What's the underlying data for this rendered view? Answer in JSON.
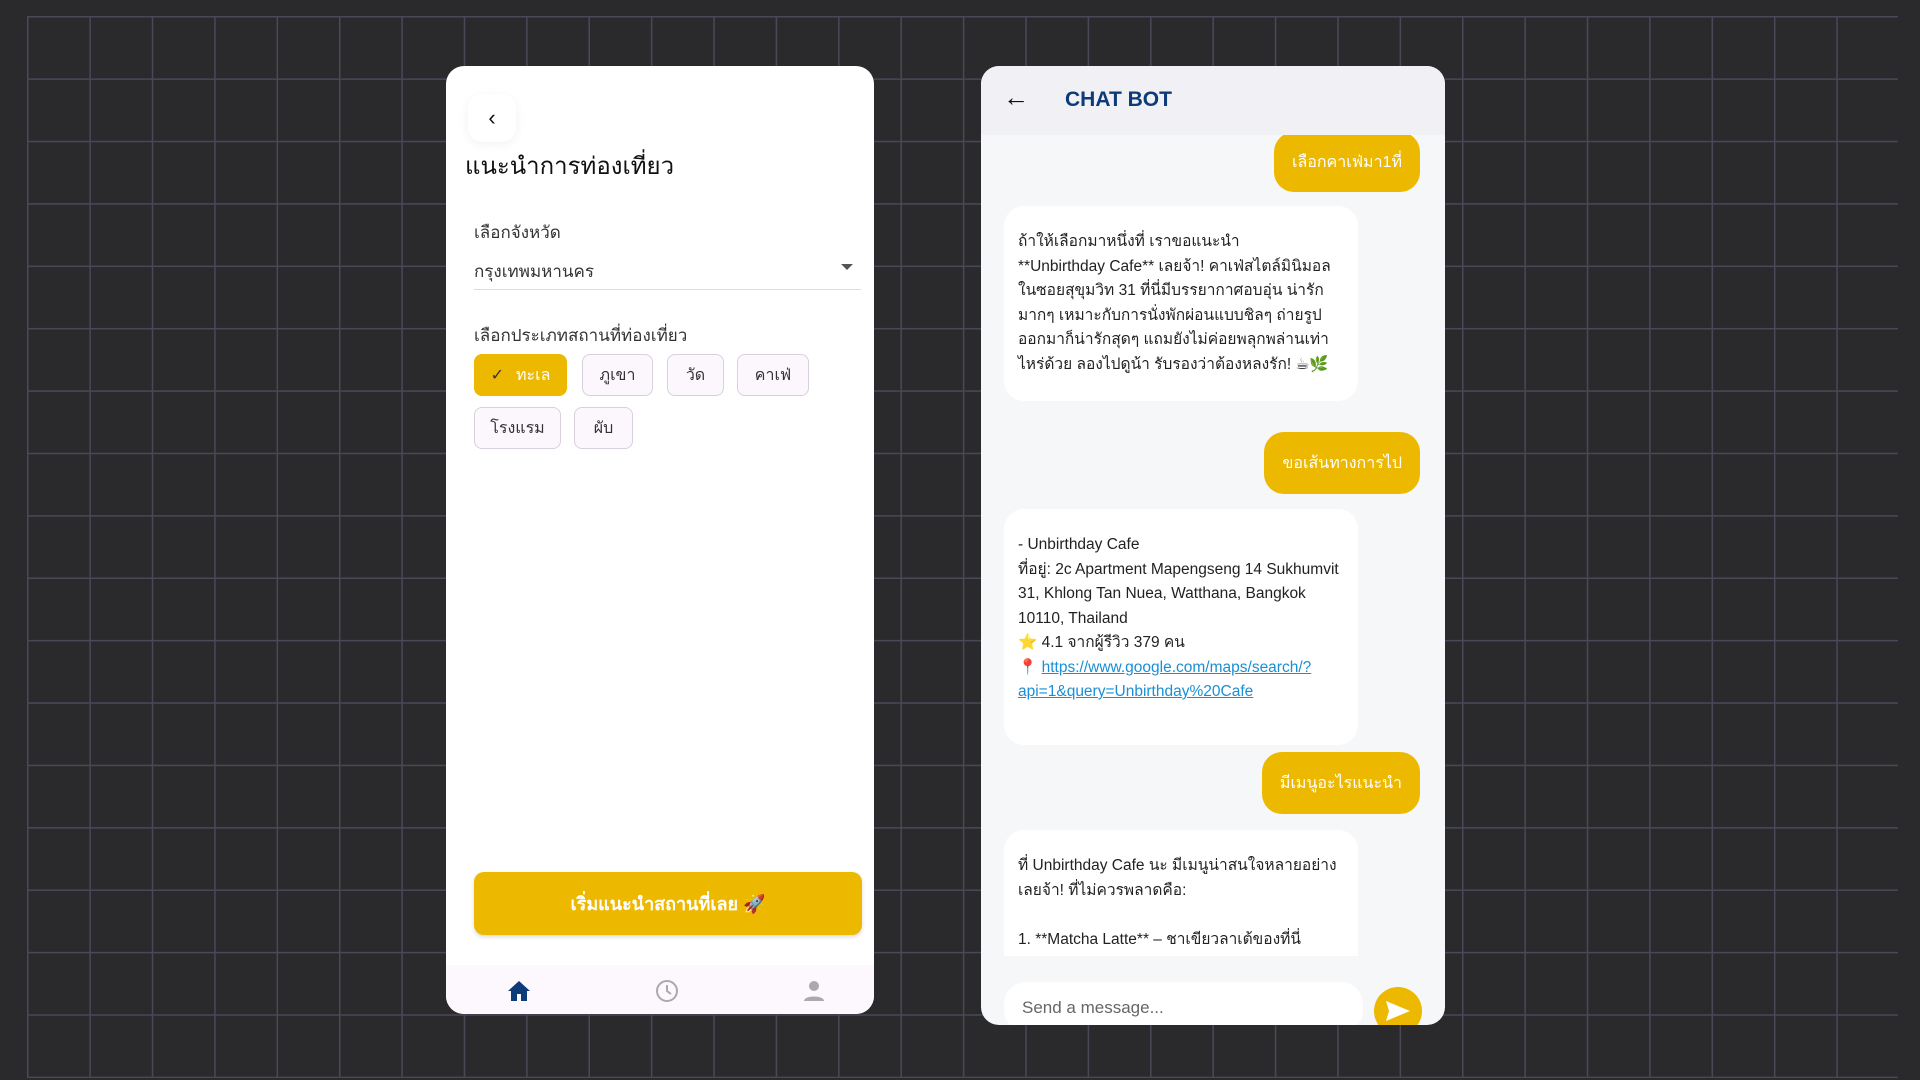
{
  "colors": {
    "accent": "#ecb800",
    "title_blue": "#0d3b78",
    "link": "#1a8fd6"
  },
  "left": {
    "back_icon": "chevron-left-icon",
    "title": "แนะนำการท่องเที่ยว",
    "province_label": "เลือกจังหวัด",
    "province_value": "กรุงเทพมหานคร",
    "category_label": "เลือกประเภทสถานที่ท่องเที่ยว",
    "chips": [
      {
        "label": "ทะเล",
        "selected": true
      },
      {
        "label": "ภูเขา",
        "selected": false
      },
      {
        "label": "วัด",
        "selected": false
      },
      {
        "label": "คาเฟ่",
        "selected": false
      },
      {
        "label": "โรงแรม",
        "selected": false
      },
      {
        "label": "ผับ",
        "selected": false
      }
    ],
    "start_button": "เริ่มแนะนำสถานที่เลย 🚀",
    "nav": [
      {
        "icon": "home-icon",
        "active": true
      },
      {
        "icon": "clock-icon",
        "active": false
      },
      {
        "icon": "person-icon",
        "active": false
      }
    ]
  },
  "chat": {
    "title": "CHAT BOT",
    "messages": [
      {
        "from": "user",
        "text": "เลือกคาเฟ่มา1ที่"
      },
      {
        "from": "bot",
        "text": "ถ้าให้เลือกมาหนึ่งที่ เราขอแนะนำ\n**Unbirthday Cafe** เลยจ้า! คาเฟ่สไตล์มินิมอลในซอยสุขุมวิท 31 ที่นี่มีบรรยากาศอบอุ่น น่ารักมากๆ เหมาะกับการนั่งพักผ่อนแบบชิลๆ ถ่ายรูปออกมาก็น่ารักสุดๆ แถมยังไม่ค่อยพลุกพล่านเท่าไหร่ด้วย ลองไปดูน้า รับรองว่าต้องหลงรัก! ☕🌿"
      },
      {
        "from": "user",
        "text": "ขอเส้นทางการไป"
      },
      {
        "from": "bot",
        "text": "- Unbirthday Cafe\nที่อยู่: 2c Apartment Mapengseng 14 Sukhumvit 31, Khlong Tan Nuea, Watthana, Bangkok 10110, Thailand\n⭐ 4.1 จากผู้รีวิว 379 คน\n📍 ",
        "link": "https://www.google.com/maps/search/?api=1&query=Unbirthday%20Cafe"
      },
      {
        "from": "user",
        "text": "มีเมนูอะไรแนะนำ"
      },
      {
        "from": "bot",
        "text": "ที่ Unbirthday Cafe นะ มีเมนูน่าสนใจหลายอย่างเลยจ้า! ที่ไม่ควรพลาดคือ:\n\n1. **Matcha Latte** – ชาเขียวลาเต้ของที่นี่"
      }
    ],
    "input_placeholder": "Send a message..."
  }
}
